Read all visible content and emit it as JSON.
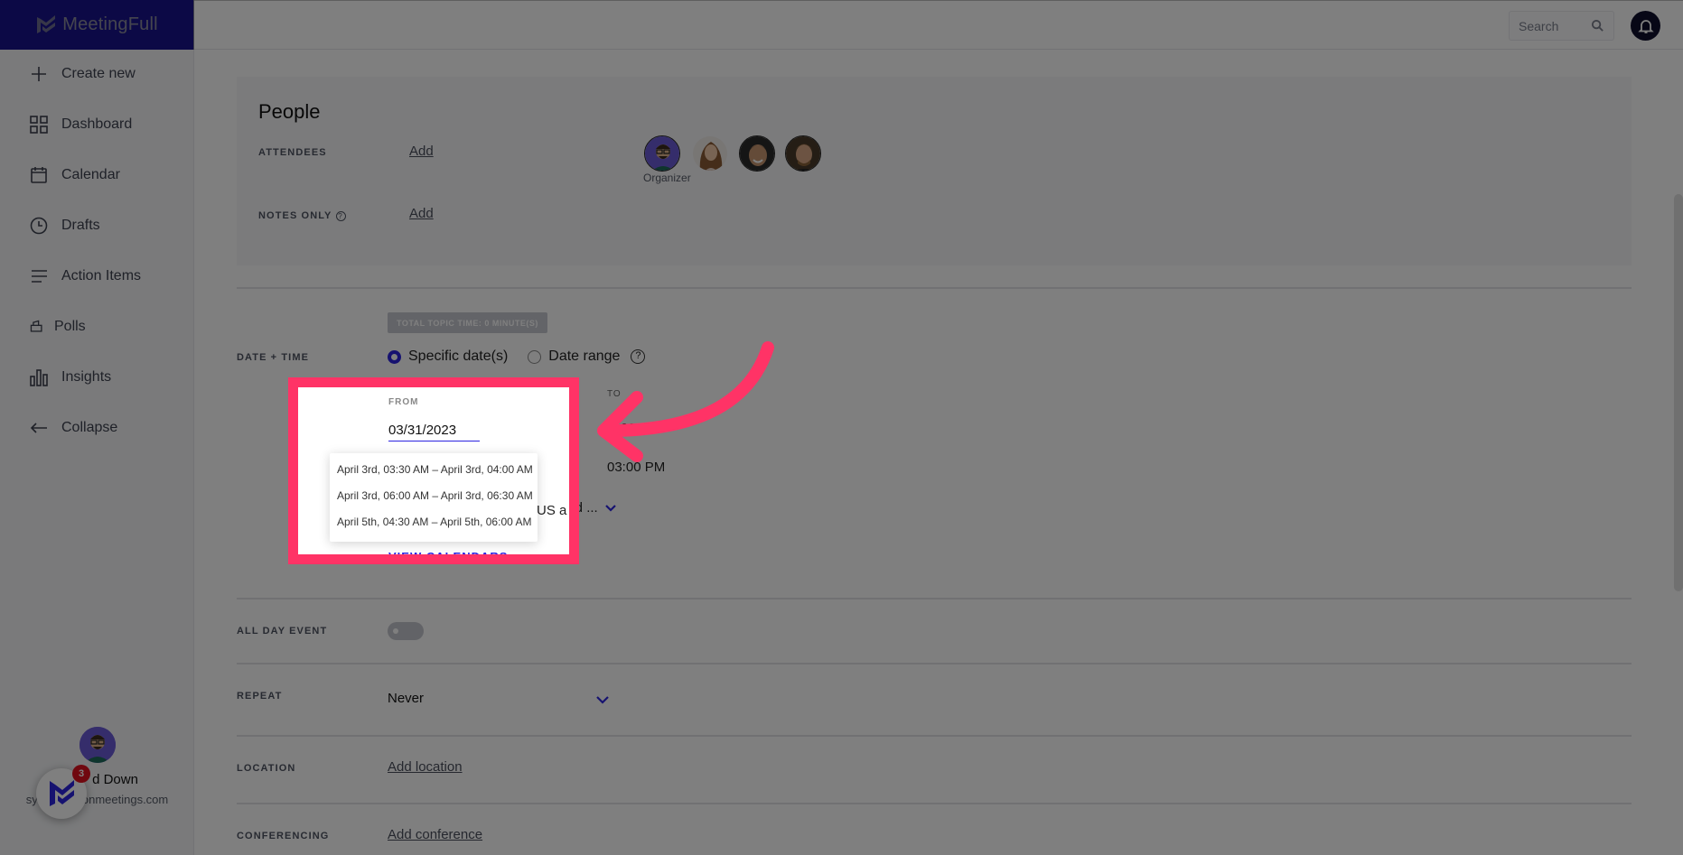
{
  "app": {
    "name": "MeetingFull",
    "brand_color": "#2c24e0",
    "highlight_color": "#ff3366"
  },
  "sidebar": {
    "items": [
      {
        "label": "Create new",
        "icon": "plus-icon"
      },
      {
        "label": "Dashboard",
        "icon": "grid-icon"
      },
      {
        "label": "Calendar",
        "icon": "calendar-icon"
      },
      {
        "label": "Drafts",
        "icon": "clock-icon"
      },
      {
        "label": "Action Items",
        "icon": "list-icon"
      },
      {
        "label": "Polls",
        "icon": "ballot-box-icon"
      },
      {
        "label": "Insights",
        "icon": "bar-chart-icon"
      },
      {
        "label": "Collapse",
        "icon": "arrow-left-icon"
      }
    ],
    "user": {
      "name_visible": "d Down",
      "email_visible": "syd.d…moonmeetings.com"
    },
    "launcher_badge": "3"
  },
  "topbar": {
    "search_placeholder": "Search"
  },
  "people": {
    "title": "People",
    "attendees_label": "ATTENDEES",
    "attendees_add": "Add",
    "notes_only_label": "NOTES ONLY",
    "notes_only_add": "Add",
    "organizer_label": "Organizer",
    "attendee_count": 4
  },
  "date_time": {
    "label": "DATE + TIME",
    "topic_time_badge": "TOTAL TOPIC TIME: 0 MINUTE(S)",
    "options": [
      {
        "label": "Specific date(s)",
        "checked": true
      },
      {
        "label": "Date range",
        "checked": false
      }
    ],
    "help": "?",
    "from_label": "FROM",
    "from_value": "03/31/2023",
    "to_label": "TO",
    "to_date_partial": "…23",
    "to_time": "03:00 PM",
    "timezone_partial": "(US and ...",
    "suggestions": [
      "April 3rd, 03:30 AM – April 3rd, 04:00 AM",
      "April 3rd, 06:00 AM – April 3rd, 06:30 AM",
      "April 5th, 04:30 AM – April 5th, 06:00 AM"
    ],
    "view_calendars": "VIEW CALENDARS"
  },
  "all_day": {
    "label": "ALL DAY EVENT",
    "enabled": false
  },
  "repeat": {
    "label": "REPEAT",
    "value": "Never"
  },
  "location": {
    "label": "LOCATION",
    "add": "Add location"
  },
  "conferencing": {
    "label": "CONFERENCING",
    "add": "Add conference"
  }
}
